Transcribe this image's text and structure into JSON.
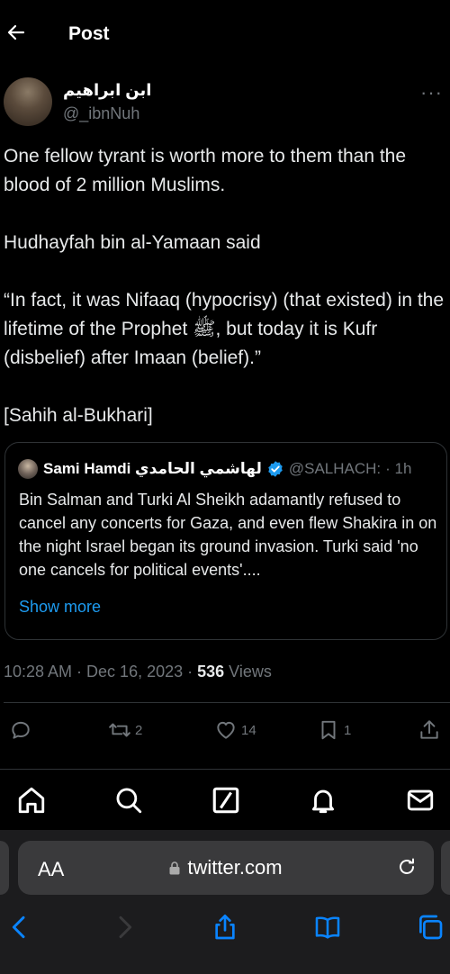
{
  "header": {
    "title": "Post"
  },
  "author": {
    "display_name": "ابن ابراهيم",
    "handle": "@_ibnNuh",
    "more": "···"
  },
  "post": {
    "paragraphs": [
      "One fellow tyrant is worth more to them than the blood of 2 million Muslims.",
      "Hudhayfah bin al-Yamaan said",
      "“In fact, it was Nifaaq (hypocrisy) (that existed) in the lifetime of the Prophet ﷺ, but today it is Kufr (disbelief) after Imaan (belief).”",
      "[Sahih al-Bukhari]"
    ]
  },
  "quote": {
    "name": "Sami Hamdi لهاشمي الحامدي",
    "handle": "@SALHACH:",
    "time": "· 1h",
    "text": "Bin Salman and Turki Al Sheikh adamantly refused to cancel any concerts for Gaza, and even flew Shakira in on the night Israel began its ground invasion. Turki said 'no one cancels for political events'....",
    "show_more": "Show more"
  },
  "meta": {
    "timestamp": "10:28 AM · Dec 16, 2023 · ",
    "views_count": "536",
    "views_label": " Views"
  },
  "actions": {
    "reposts": "2",
    "likes": "14",
    "bookmarks": "1"
  },
  "browser": {
    "aa": "AA",
    "url": "twitter.com"
  },
  "colors": {
    "accent": "#1d9bf0",
    "muted": "#71767b",
    "text": "#e7e9ea",
    "divider": "#2f3336"
  }
}
